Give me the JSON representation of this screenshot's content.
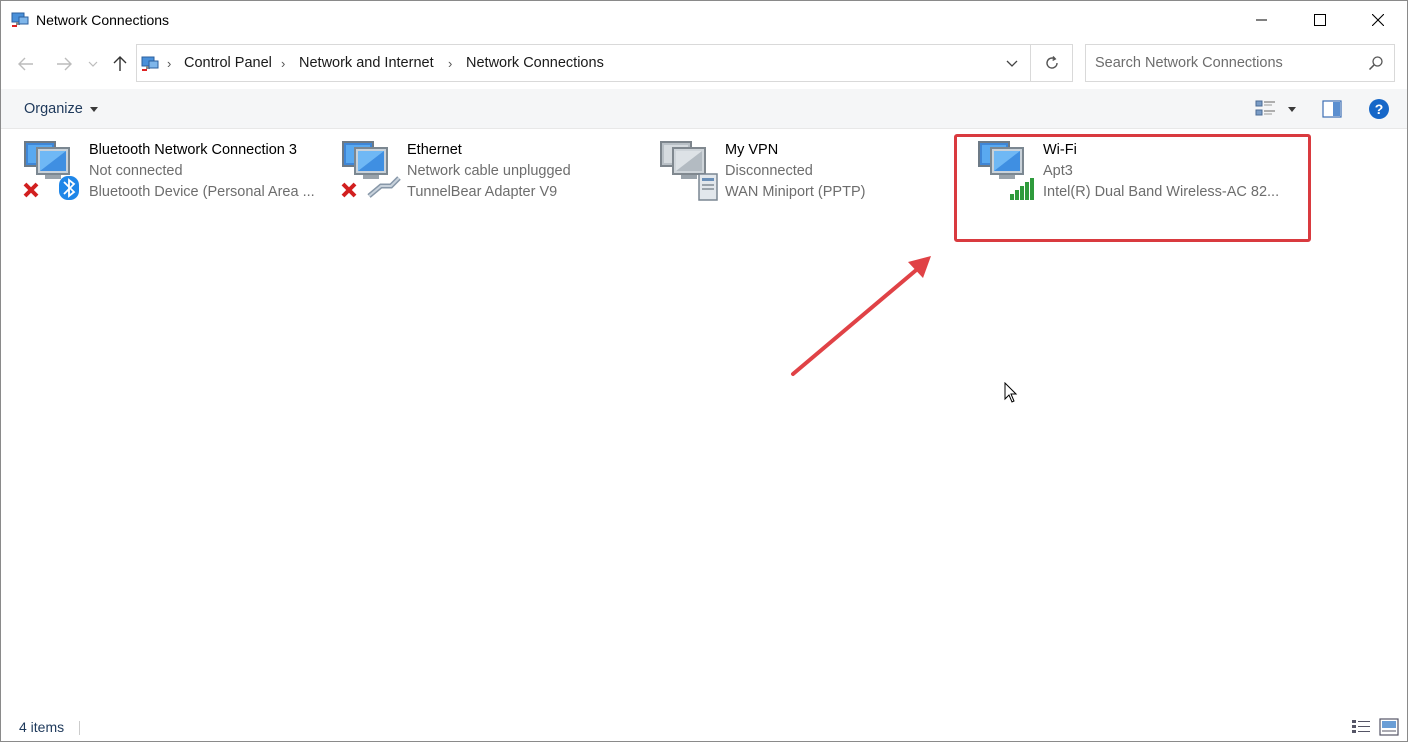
{
  "window": {
    "title": "Network Connections",
    "title_icon": "network-connections-icon"
  },
  "nav": {
    "breadcrumb": [
      "Control Panel",
      "Network and Internet",
      "Network Connections"
    ],
    "search_placeholder": "Search Network Connections"
  },
  "command_bar": {
    "organize_label": "Organize"
  },
  "connections": [
    {
      "name": "Bluetooth Network Connection 3",
      "status": "Not connected",
      "device": "Bluetooth Device (Personal Area ...",
      "icon": "bluetooth-network-icon",
      "state_badge": "disconnected-x-icon"
    },
    {
      "name": "Ethernet",
      "status": "Network cable unplugged",
      "device": "TunnelBear Adapter V9",
      "icon": "ethernet-network-icon",
      "state_badge": "disconnected-x-icon"
    },
    {
      "name": "My VPN",
      "status": "Disconnected",
      "device": "WAN Miniport (PPTP)",
      "icon": "vpn-network-icon"
    },
    {
      "name": "Wi-Fi",
      "status": "Apt3",
      "device": "Intel(R) Dual Band Wireless-AC 82...",
      "icon": "wifi-network-icon",
      "signal_bars": 5
    }
  ],
  "status_bar": {
    "item_count": "4 items"
  },
  "colors": {
    "highlight": "#d93a3f",
    "link_text": "#1e395b",
    "secondary_text": "#6d6d6d"
  }
}
